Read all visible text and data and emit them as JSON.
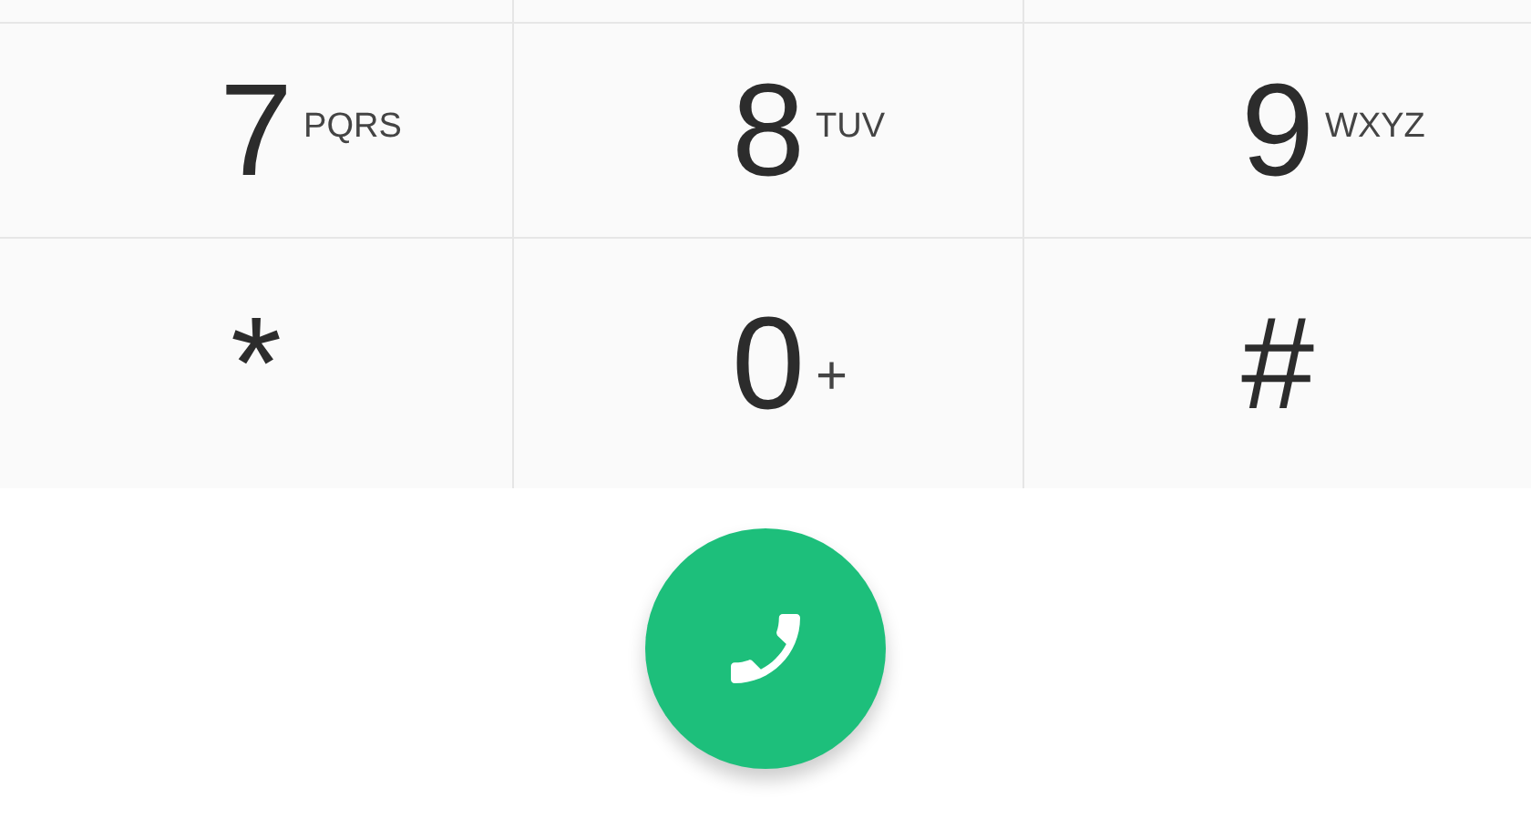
{
  "keys": [
    {
      "digit": "7",
      "letters": "PQRS"
    },
    {
      "digit": "8",
      "letters": "TUV"
    },
    {
      "digit": "9",
      "letters": "WXYZ"
    },
    {
      "digit": "*"
    },
    {
      "digit": "0",
      "letters": "+"
    },
    {
      "digit": "#"
    }
  ],
  "call_button": {
    "kind": "call"
  }
}
